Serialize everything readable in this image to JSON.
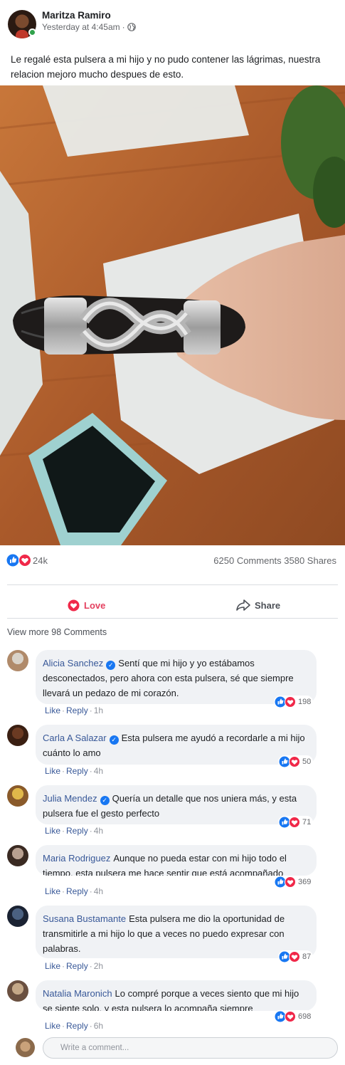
{
  "post": {
    "author": "Maritza Ramiro",
    "timestamp": "Yesterday at 4:45am",
    "separator": "·",
    "text": "Le regalé esta pulsera a mi hijo y no pudo contener las lágrimas, nuestra relacion mejoro mucho despues de esto.",
    "reaction_count": "24k",
    "stats": "6250 Comments 3580 Shares"
  },
  "actions": {
    "love_label": "Love",
    "share_label": "Share"
  },
  "comments_section": {
    "view_more": "View more 98 Comments",
    "like_label": "Like",
    "reply_label": "Reply",
    "dot": "·",
    "items": [
      {
        "name": "Alicia Sanchez",
        "verified": true,
        "text": "Sentí que mi hijo y yo estábamos desconectados, pero ahora con esta pulsera, sé que siempre llevará un pedazo de mi corazón.",
        "time": "1h",
        "reactions": "198"
      },
      {
        "name": "Carla A Salazar",
        "verified": true,
        "text": "Esta pulsera me ayudó a recordarle a mi hijo cuánto lo amo",
        "time": "4h",
        "reactions": "50"
      },
      {
        "name": "Julia Mendez",
        "verified": true,
        "text": "Quería un detalle que nos uniera más, y esta pulsera fue el gesto perfecto",
        "time": "4h",
        "reactions": "71"
      },
      {
        "name": "Maria Rodriguez",
        "verified": false,
        "text": "Aunque no pueda estar con mi hijo todo el tiempo, esta pulsera me hace sentir que está acompañado",
        "time": "4h",
        "reactions": "369"
      },
      {
        "name": "Susana Bustamante",
        "verified": false,
        "text": "Esta pulsera me dio la oportunidad de transmitirle a mi hijo lo que a veces no puedo expresar con palabras.",
        "time": "2h",
        "reactions": "87"
      },
      {
        "name": "Natalia Maronich",
        "verified": false,
        "text": "Lo compré porque a veces siento que mi hijo se siente solo, y esta pulsera lo acompaña siempre",
        "time": "6h",
        "reactions": "698"
      }
    ]
  },
  "composer": {
    "placeholder": "Write a comment..."
  },
  "colors": {
    "link": "#385898",
    "love": "#e4405f",
    "like": "#1877f2",
    "bubble": "#f0f2f5"
  }
}
